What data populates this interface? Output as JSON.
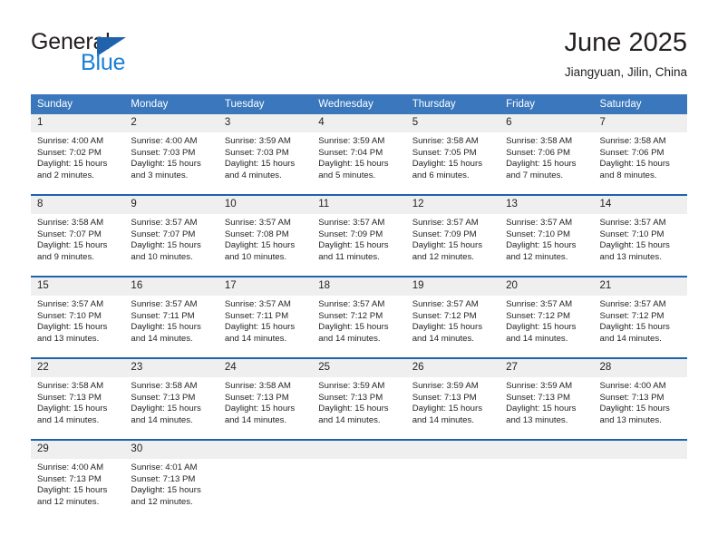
{
  "logo": {
    "word_top": "General",
    "word_bottom": "Blue",
    "triangle_color": "#1f63ac",
    "blue_color": "#1a7fd4"
  },
  "header": {
    "title": "June 2025",
    "subtitle": "Jiangyuan, Jilin, China"
  },
  "colors": {
    "header_row": "#3a77bd",
    "row_separator": "#1f63ac",
    "daynum_background": "#efefef",
    "text": "#231f20"
  },
  "weekday_headers": [
    "Sunday",
    "Monday",
    "Tuesday",
    "Wednesday",
    "Thursday",
    "Friday",
    "Saturday"
  ],
  "labels": {
    "sunrise_prefix": "Sunrise:",
    "sunset_prefix": "Sunset:",
    "daylight_prefix": "Daylight:"
  },
  "weeks": [
    [
      {
        "day": "1",
        "sunrise": "Sunrise: 4:00 AM",
        "sunset": "Sunset: 7:02 PM",
        "daylight_1": "Daylight: 15 hours",
        "daylight_2": "and 2 minutes."
      },
      {
        "day": "2",
        "sunrise": "Sunrise: 4:00 AM",
        "sunset": "Sunset: 7:03 PM",
        "daylight_1": "Daylight: 15 hours",
        "daylight_2": "and 3 minutes."
      },
      {
        "day": "3",
        "sunrise": "Sunrise: 3:59 AM",
        "sunset": "Sunset: 7:03 PM",
        "daylight_1": "Daylight: 15 hours",
        "daylight_2": "and 4 minutes."
      },
      {
        "day": "4",
        "sunrise": "Sunrise: 3:59 AM",
        "sunset": "Sunset: 7:04 PM",
        "daylight_1": "Daylight: 15 hours",
        "daylight_2": "and 5 minutes."
      },
      {
        "day": "5",
        "sunrise": "Sunrise: 3:58 AM",
        "sunset": "Sunset: 7:05 PM",
        "daylight_1": "Daylight: 15 hours",
        "daylight_2": "and 6 minutes."
      },
      {
        "day": "6",
        "sunrise": "Sunrise: 3:58 AM",
        "sunset": "Sunset: 7:06 PM",
        "daylight_1": "Daylight: 15 hours",
        "daylight_2": "and 7 minutes."
      },
      {
        "day": "7",
        "sunrise": "Sunrise: 3:58 AM",
        "sunset": "Sunset: 7:06 PM",
        "daylight_1": "Daylight: 15 hours",
        "daylight_2": "and 8 minutes."
      }
    ],
    [
      {
        "day": "8",
        "sunrise": "Sunrise: 3:58 AM",
        "sunset": "Sunset: 7:07 PM",
        "daylight_1": "Daylight: 15 hours",
        "daylight_2": "and 9 minutes."
      },
      {
        "day": "9",
        "sunrise": "Sunrise: 3:57 AM",
        "sunset": "Sunset: 7:07 PM",
        "daylight_1": "Daylight: 15 hours",
        "daylight_2": "and 10 minutes."
      },
      {
        "day": "10",
        "sunrise": "Sunrise: 3:57 AM",
        "sunset": "Sunset: 7:08 PM",
        "daylight_1": "Daylight: 15 hours",
        "daylight_2": "and 10 minutes."
      },
      {
        "day": "11",
        "sunrise": "Sunrise: 3:57 AM",
        "sunset": "Sunset: 7:09 PM",
        "daylight_1": "Daylight: 15 hours",
        "daylight_2": "and 11 minutes."
      },
      {
        "day": "12",
        "sunrise": "Sunrise: 3:57 AM",
        "sunset": "Sunset: 7:09 PM",
        "daylight_1": "Daylight: 15 hours",
        "daylight_2": "and 12 minutes."
      },
      {
        "day": "13",
        "sunrise": "Sunrise: 3:57 AM",
        "sunset": "Sunset: 7:10 PM",
        "daylight_1": "Daylight: 15 hours",
        "daylight_2": "and 12 minutes."
      },
      {
        "day": "14",
        "sunrise": "Sunrise: 3:57 AM",
        "sunset": "Sunset: 7:10 PM",
        "daylight_1": "Daylight: 15 hours",
        "daylight_2": "and 13 minutes."
      }
    ],
    [
      {
        "day": "15",
        "sunrise": "Sunrise: 3:57 AM",
        "sunset": "Sunset: 7:10 PM",
        "daylight_1": "Daylight: 15 hours",
        "daylight_2": "and 13 minutes."
      },
      {
        "day": "16",
        "sunrise": "Sunrise: 3:57 AM",
        "sunset": "Sunset: 7:11 PM",
        "daylight_1": "Daylight: 15 hours",
        "daylight_2": "and 14 minutes."
      },
      {
        "day": "17",
        "sunrise": "Sunrise: 3:57 AM",
        "sunset": "Sunset: 7:11 PM",
        "daylight_1": "Daylight: 15 hours",
        "daylight_2": "and 14 minutes."
      },
      {
        "day": "18",
        "sunrise": "Sunrise: 3:57 AM",
        "sunset": "Sunset: 7:12 PM",
        "daylight_1": "Daylight: 15 hours",
        "daylight_2": "and 14 minutes."
      },
      {
        "day": "19",
        "sunrise": "Sunrise: 3:57 AM",
        "sunset": "Sunset: 7:12 PM",
        "daylight_1": "Daylight: 15 hours",
        "daylight_2": "and 14 minutes."
      },
      {
        "day": "20",
        "sunrise": "Sunrise: 3:57 AM",
        "sunset": "Sunset: 7:12 PM",
        "daylight_1": "Daylight: 15 hours",
        "daylight_2": "and 14 minutes."
      },
      {
        "day": "21",
        "sunrise": "Sunrise: 3:57 AM",
        "sunset": "Sunset: 7:12 PM",
        "daylight_1": "Daylight: 15 hours",
        "daylight_2": "and 14 minutes."
      }
    ],
    [
      {
        "day": "22",
        "sunrise": "Sunrise: 3:58 AM",
        "sunset": "Sunset: 7:13 PM",
        "daylight_1": "Daylight: 15 hours",
        "daylight_2": "and 14 minutes."
      },
      {
        "day": "23",
        "sunrise": "Sunrise: 3:58 AM",
        "sunset": "Sunset: 7:13 PM",
        "daylight_1": "Daylight: 15 hours",
        "daylight_2": "and 14 minutes."
      },
      {
        "day": "24",
        "sunrise": "Sunrise: 3:58 AM",
        "sunset": "Sunset: 7:13 PM",
        "daylight_1": "Daylight: 15 hours",
        "daylight_2": "and 14 minutes."
      },
      {
        "day": "25",
        "sunrise": "Sunrise: 3:59 AM",
        "sunset": "Sunset: 7:13 PM",
        "daylight_1": "Daylight: 15 hours",
        "daylight_2": "and 14 minutes."
      },
      {
        "day": "26",
        "sunrise": "Sunrise: 3:59 AM",
        "sunset": "Sunset: 7:13 PM",
        "daylight_1": "Daylight: 15 hours",
        "daylight_2": "and 14 minutes."
      },
      {
        "day": "27",
        "sunrise": "Sunrise: 3:59 AM",
        "sunset": "Sunset: 7:13 PM",
        "daylight_1": "Daylight: 15 hours",
        "daylight_2": "and 13 minutes."
      },
      {
        "day": "28",
        "sunrise": "Sunrise: 4:00 AM",
        "sunset": "Sunset: 7:13 PM",
        "daylight_1": "Daylight: 15 hours",
        "daylight_2": "and 13 minutes."
      }
    ],
    [
      {
        "day": "29",
        "sunrise": "Sunrise: 4:00 AM",
        "sunset": "Sunset: 7:13 PM",
        "daylight_1": "Daylight: 15 hours",
        "daylight_2": "and 12 minutes."
      },
      {
        "day": "30",
        "sunrise": "Sunrise: 4:01 AM",
        "sunset": "Sunset: 7:13 PM",
        "daylight_1": "Daylight: 15 hours",
        "daylight_2": "and 12 minutes."
      },
      {
        "day": "",
        "sunrise": "",
        "sunset": "",
        "daylight_1": "",
        "daylight_2": ""
      },
      {
        "day": "",
        "sunrise": "",
        "sunset": "",
        "daylight_1": "",
        "daylight_2": ""
      },
      {
        "day": "",
        "sunrise": "",
        "sunset": "",
        "daylight_1": "",
        "daylight_2": ""
      },
      {
        "day": "",
        "sunrise": "",
        "sunset": "",
        "daylight_1": "",
        "daylight_2": ""
      },
      {
        "day": "",
        "sunrise": "",
        "sunset": "",
        "daylight_1": "",
        "daylight_2": ""
      }
    ]
  ]
}
